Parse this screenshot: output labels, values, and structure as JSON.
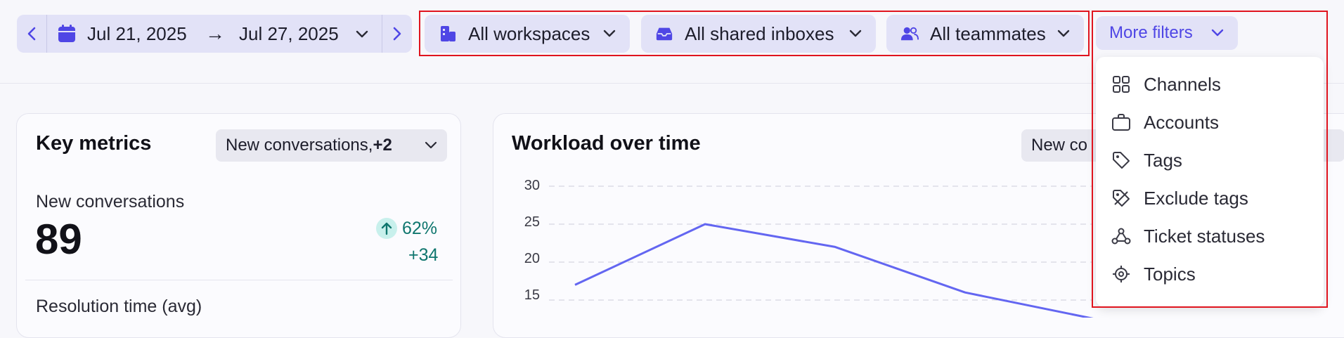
{
  "date_range": {
    "prev_icon": "chevron-left-icon",
    "calendar_icon": "calendar-icon",
    "start": "Jul 21, 2025",
    "arrow": "→",
    "end": "Jul 27, 2025",
    "next_icon": "chevron-right-icon"
  },
  "filters": {
    "workspaces": {
      "label": "All workspaces",
      "icon": "building-icon"
    },
    "inboxes": {
      "label": "All shared inboxes",
      "icon": "inbox-icon"
    },
    "teammates": {
      "label": "All teammates",
      "icon": "users-icon"
    },
    "more": {
      "label": "More filters"
    }
  },
  "more_filters_menu": [
    {
      "label": "Channels",
      "icon": "grid-icon"
    },
    {
      "label": "Accounts",
      "icon": "briefcase-icon"
    },
    {
      "label": "Tags",
      "icon": "tag-icon"
    },
    {
      "label": "Exclude tags",
      "icon": "tag-slash-icon"
    },
    {
      "label": "Ticket statuses",
      "icon": "ticket-status-icon"
    },
    {
      "label": "Topics",
      "icon": "target-icon"
    }
  ],
  "key_metrics": {
    "title": "Key metrics",
    "select_prefix": "New conversations, ",
    "select_suffix": "+2",
    "new_conversations": {
      "label": "New conversations",
      "value": "89",
      "delta_pct": "62%",
      "delta_abs": "+34"
    },
    "resolution_label": "Resolution time (avg)"
  },
  "workload": {
    "title": "Workload over time",
    "select_visible": "New co"
  },
  "chart_data": {
    "type": "line",
    "title": "Workload over time",
    "xlabel": "",
    "ylabel": "",
    "y_ticks": [
      "30",
      "25",
      "20",
      "15"
    ],
    "ylim": [
      12.5,
      30
    ],
    "grid": true,
    "series": [
      {
        "values": [
          17,
          25,
          22,
          16,
          12.5
        ],
        "color": "#6366f1"
      }
    ]
  },
  "colors": {
    "accent": "#4f46e5",
    "highlight": "#e0141e",
    "positive": "#0f766e",
    "chart_line": "#6366f1"
  }
}
